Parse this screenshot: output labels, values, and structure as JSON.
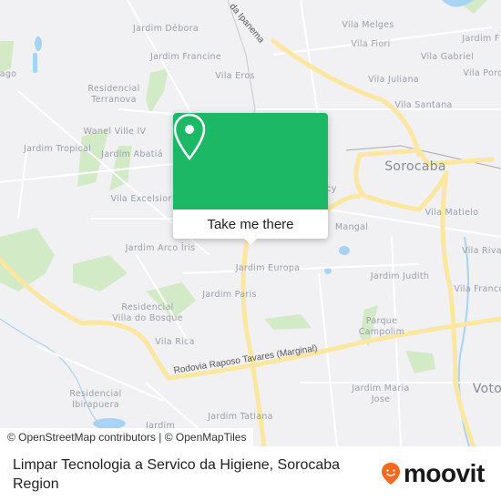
{
  "map": {
    "labels": [
      {
        "text": "Jardim Débora"
      },
      {
        "text": "Jardim Francine"
      },
      {
        "text": "Vila Eros"
      },
      {
        "text": "Residencial Terranova"
      },
      {
        "text": "Wanel Ville IV"
      },
      {
        "text": "Jardim Tropical"
      },
      {
        "text": "Jardim Abatiá"
      },
      {
        "text": "Vila Excelsior"
      },
      {
        "text": "Jardim Arco Íris"
      },
      {
        "text": "Jardim Europa"
      },
      {
        "text": "Jardim Paris"
      },
      {
        "text": "Residencial Villa do Bosque"
      },
      {
        "text": "Vila Rica"
      },
      {
        "text": "Residencial Ibirapuera"
      },
      {
        "text": "Jardim Tatiana"
      },
      {
        "text": "Jardim"
      },
      {
        "text": "Vila Melges"
      },
      {
        "text": "Vila Fiori"
      },
      {
        "text": "Jardim F"
      },
      {
        "text": "Vila Gabriel"
      },
      {
        "text": "Vila Porc"
      },
      {
        "text": "Vila Juliana"
      },
      {
        "text": "Vila Santana"
      },
      {
        "text": "Sorocaba"
      },
      {
        "text": "Vila Matielo"
      },
      {
        "text": "Mangal"
      },
      {
        "text": "Vila Riva"
      },
      {
        "text": "Jardim Judith"
      },
      {
        "text": "Vila Franco"
      },
      {
        "text": "Parque Campolim"
      },
      {
        "text": "Jardim Maria Jose"
      },
      {
        "text": "Voto"
      },
      {
        "text": "ago"
      },
      {
        "text": "cy"
      }
    ],
    "roads": [
      {
        "text": "Rodovia Raposo Tavares (Marginal)"
      },
      {
        "text": "da Ipanema"
      }
    ],
    "colors": {
      "background": "#f1f1f3",
      "major_road": "#fbe7a1",
      "park": "#cfe8c0",
      "water": "#a9d3f2"
    }
  },
  "popup": {
    "icon": "map-pin-icon",
    "button_label": "Take me there",
    "color": "#1db865"
  },
  "attribution": "© OpenStreetMap contributors | © OpenMapTiles",
  "footer": {
    "title": "Limpar Tecnologia a Servico da Higiene, Sorocaba Region",
    "logo_text": "moovit",
    "logo_color": "#f26b21"
  }
}
